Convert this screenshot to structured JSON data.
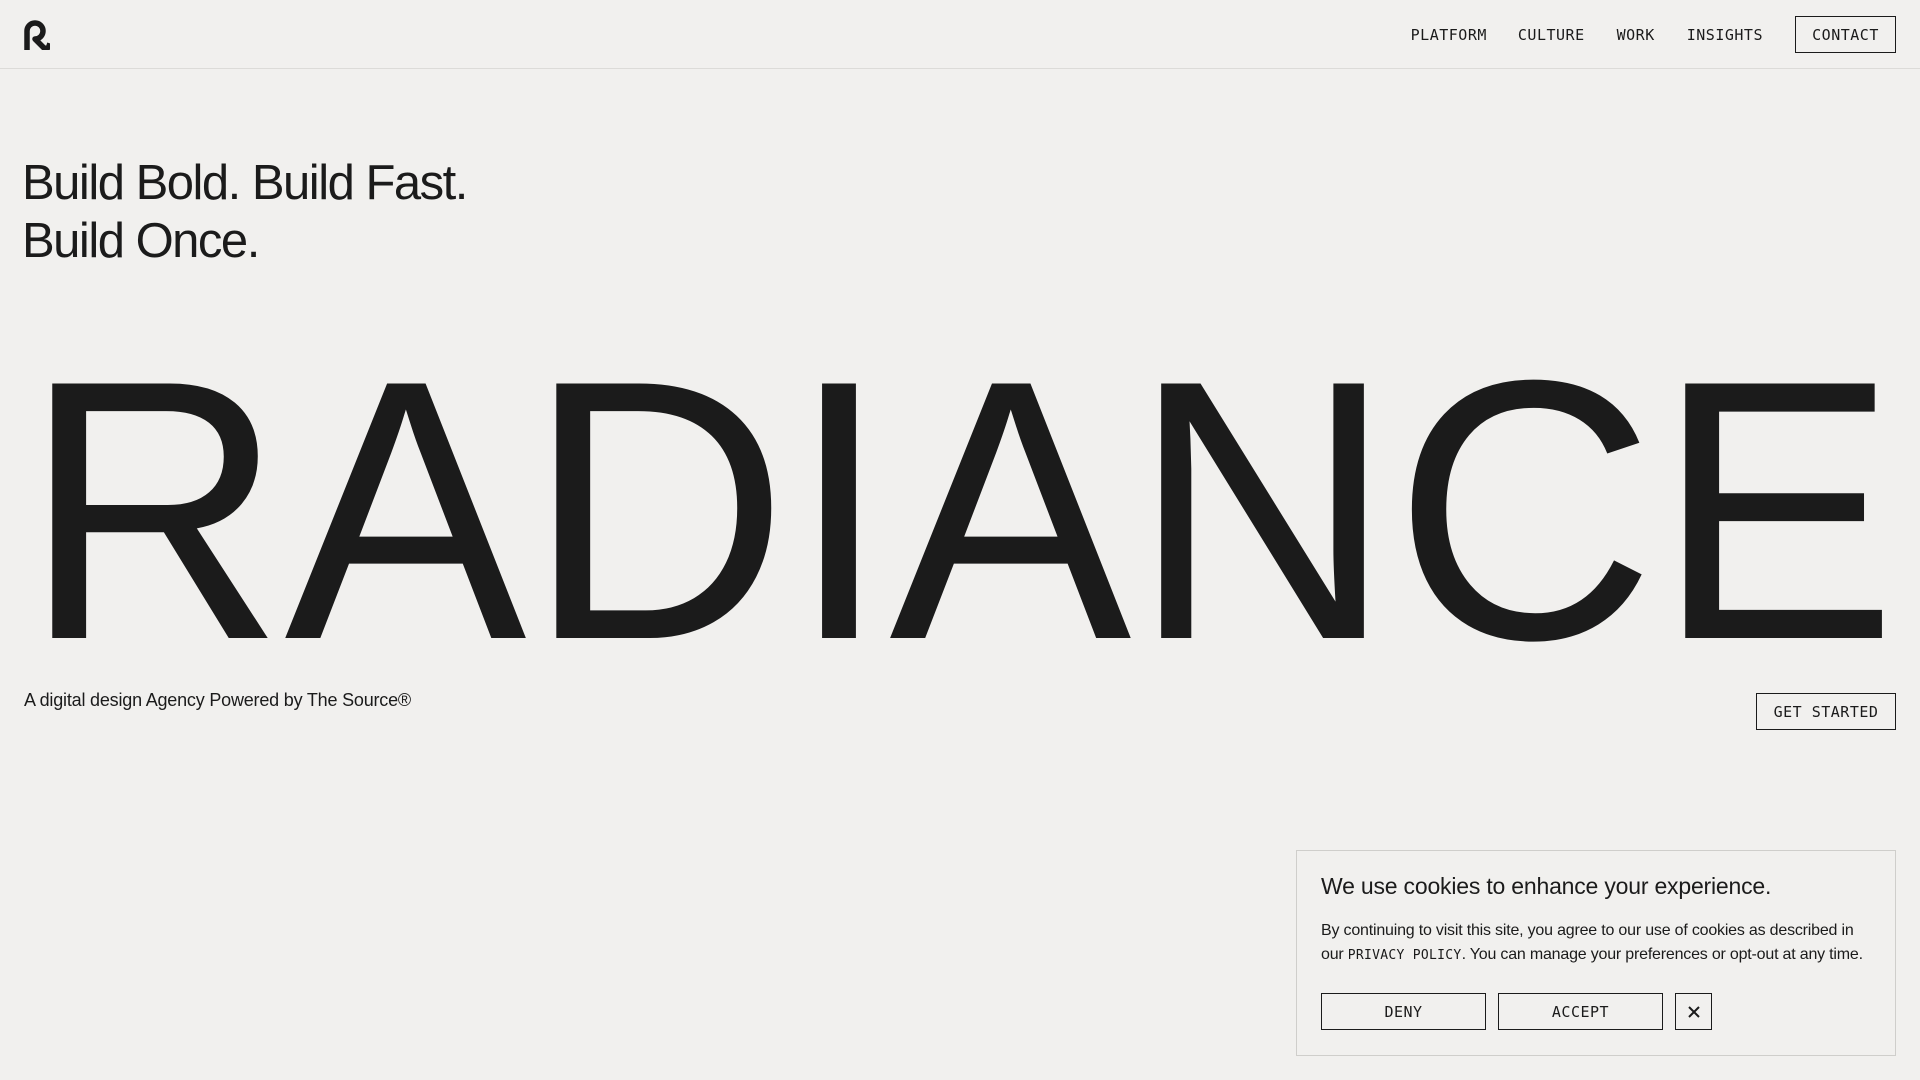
{
  "header": {
    "logo_icon": "radiance-r-logo-icon",
    "nav": [
      "PLATFORM",
      "CULTURE",
      "WORK",
      "INSIGHTS"
    ],
    "contact_label": "CONTACT"
  },
  "hero": {
    "tagline_line1": "Build Bold. Build Fast.",
    "tagline_line2": "Build Once.",
    "wordmark": "RADIANCE",
    "subline": "A digital design Agency Powered by The Source®",
    "cta_label": "GET STARTED"
  },
  "cookie_banner": {
    "title": "We use cookies to enhance your experience.",
    "text_before": "By continuing to visit this site, you agree to our use of cookies as described in our ",
    "policy_link": "PRIVACY POLICY",
    "text_after": ". You can manage your preferences or opt-out at any time.",
    "deny_label": "DENY",
    "accept_label": "ACCEPT",
    "close_icon": "close-icon"
  },
  "colors": {
    "background": "#f1f0ee",
    "text": "#1b1b1b",
    "border": "#cfcecb"
  }
}
